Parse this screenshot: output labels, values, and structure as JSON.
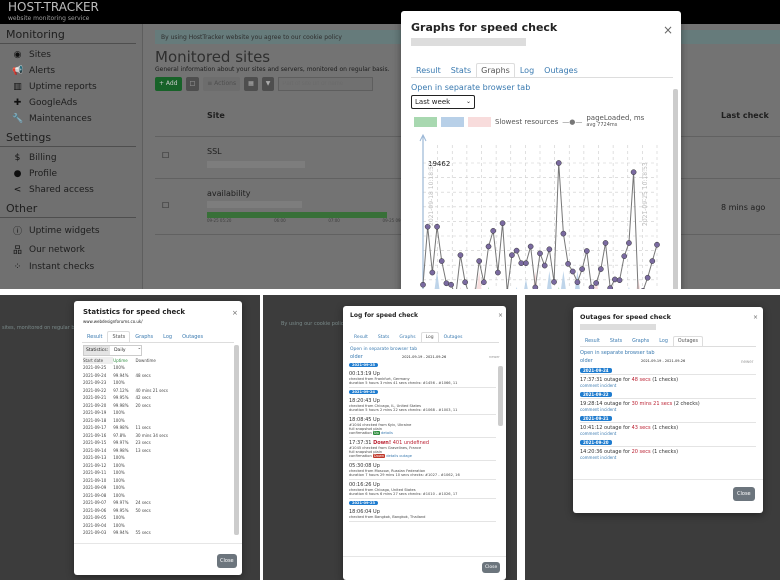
{
  "app": {
    "logo": "HOST-TRACKER",
    "tagline": "website monitoring service"
  },
  "sidebar": {
    "sections": [
      {
        "title": "Monitoring",
        "items": [
          {
            "label": "Sites",
            "icon": "globe-icon"
          },
          {
            "label": "Alerts",
            "icon": "megaphone-icon"
          },
          {
            "label": "Uptime reports",
            "icon": "bar-chart-icon"
          },
          {
            "label": "GoogleAds",
            "icon": "puzzle-icon"
          },
          {
            "label": "Maintenances",
            "icon": "wrench-icon"
          }
        ]
      },
      {
        "title": "Settings",
        "items": [
          {
            "label": "Billing",
            "icon": "dollar-icon"
          },
          {
            "label": "Profile",
            "icon": "user-icon"
          },
          {
            "label": "Shared access",
            "icon": "share-icon"
          }
        ]
      },
      {
        "title": "Other",
        "items": [
          {
            "label": "Uptime widgets",
            "icon": "info-icon"
          },
          {
            "label": "Our network",
            "icon": "network-icon"
          },
          {
            "label": "Instant checks",
            "icon": "spinner-icon"
          }
        ]
      }
    ]
  },
  "main": {
    "cookie": "By using HostTracker website you agree to our cookie policy",
    "title": "Monitored sites",
    "subtitle": "General information about your sites and servers, monitored on regular basis.",
    "toolbar": {
      "add": "+ Add",
      "actions": "≡ Actions",
      "search_placeholder": "Part of site url or name"
    },
    "columns": {
      "site": "Site",
      "last_check": "Last check"
    },
    "rows": [
      {
        "name": "SSL",
        "last_check": ""
      },
      {
        "name": "availability",
        "last_check": "8 mins ago",
        "timeline": [
          "09-25 05:20",
          "06:00",
          "07:00",
          "09-25 09:20"
        ]
      }
    ]
  },
  "tabs": [
    "Result",
    "Stats",
    "Graphs",
    "Log",
    "Outages"
  ],
  "graphs_modal": {
    "title": "Graphs for speed check",
    "open_link": "Open in separate browser tab",
    "range": "Last week",
    "legend": {
      "slowest": "Slowest resources",
      "series": "pageLoaded, ms",
      "avg": "avg 7724ms"
    },
    "colors": {
      "green": "#a8d8b0",
      "blue": "#b8d0e8",
      "pink": "#f8dcdc",
      "line": "#777777",
      "point": "#7a6aa0"
    }
  },
  "chart_data": {
    "type": "line",
    "series": [
      {
        "name": "pageLoaded, ms",
        "values": [
          3240,
          10970,
          4860,
          10970,
          6390,
          3430,
          3240,
          1710,
          7180,
          3570,
          1710,
          1390,
          6390,
          3570,
          8330,
          10420,
          4860,
          11440,
          2320,
          7180,
          7780,
          6110,
          6110,
          8330,
          2870,
          7410,
          5790,
          7960,
          3610,
          19462,
          10050,
          6020,
          5000,
          3570,
          5320,
          7730,
          2870,
          3470,
          5320,
          8800,
          2780,
          3940,
          3840,
          7040,
          8800,
          18240,
          1710,
          2410,
          4170,
          6390,
          8570
        ]
      }
    ],
    "max_label": "19462",
    "x_start": "2021-09-18 10:18:53",
    "x_end": "2021-09-25 10:18:53",
    "avg": 7724,
    "grid": true
  },
  "stats_modal": {
    "title": "Statistics for speed check",
    "url": "www.webdesignforums.co.uk/",
    "stat_label": "Statistics:",
    "period": "Daily",
    "headers": [
      "Start date",
      "Uptime",
      "Downtime"
    ],
    "rows": [
      [
        "2021-09-25",
        "100%",
        ""
      ],
      [
        "2021-09-24",
        "99.94%",
        "48 secs"
      ],
      [
        "2021-09-23",
        "100%",
        ""
      ],
      [
        "2021-09-22",
        "97.12%",
        "40 mins 21 secs"
      ],
      [
        "2021-09-21",
        "99.95%",
        "42 secs"
      ],
      [
        "2021-09-20",
        "99.98%",
        "20 secs"
      ],
      [
        "2021-09-19",
        "100%",
        ""
      ],
      [
        "2021-09-18",
        "100%",
        ""
      ],
      [
        "2021-09-17",
        "99.98%",
        "11 secs"
      ],
      [
        "2021-09-16",
        "97.8%",
        "30 mins 34 secs"
      ],
      [
        "2021-09-15",
        "99.97%",
        "23 secs"
      ],
      [
        "2021-09-14",
        "99.98%",
        "13 secs"
      ],
      [
        "2021-09-13",
        "100%",
        ""
      ],
      [
        "2021-09-12",
        "100%",
        ""
      ],
      [
        "2021-09-11",
        "100%",
        ""
      ],
      [
        "2021-09-10",
        "100%",
        ""
      ],
      [
        "2021-09-09",
        "100%",
        ""
      ],
      [
        "2021-09-08",
        "100%",
        ""
      ],
      [
        "2021-09-07",
        "99.97%",
        "24 secs"
      ],
      [
        "2021-09-06",
        "99.95%",
        "50 secs"
      ],
      [
        "2021-09-05",
        "100%",
        ""
      ],
      [
        "2021-09-04",
        "100%",
        ""
      ],
      [
        "2021-09-03",
        "99.94%",
        "55 secs"
      ]
    ],
    "close": "Close"
  },
  "log_modal": {
    "title": "Log for speed check",
    "open_link": "Open in separate browser tab",
    "older": "older",
    "newer": "newer",
    "range": "2021-09-19 - 2021-09-26",
    "entries": [
      {
        "date": "2021-09-25"
      },
      {
        "time": "00:13:19 Up",
        "l1": "checked from Frankfurt, Germany",
        "l2": "duration 5 hours 3 mins 41 secs checks: #1456 - #1066, 11"
      },
      {
        "date": "2021-09-24"
      },
      {
        "time": "18:20:43 Up",
        "l1": "checked from Chicago, IL, United States",
        "l2": "duration 5 hours 2 mins 22 secs checks: #1068 - #1003, 11"
      },
      {
        "time": "18:08:45 Up",
        "l1": "#1044 checked from Kyiv, Ukraine",
        "l2": "full snapshot plain",
        "conf": "confirmation",
        "tag": "Up",
        "tagc": "#2a8a3a",
        "links": "details"
      },
      {
        "time": "17:37:31",
        "down": "Down!",
        "err": "401 undefined",
        "l1": "#1045 checked from Gravelines, France",
        "l2": "full snapshot plain",
        "conf": "confirmation",
        "tag": "Down",
        "tagc": "#c0392b",
        "links": "details outage"
      },
      {
        "time": "05:30:08 Up",
        "l1": "checked from Moscow, Russian Federation",
        "l2": "duration 7 hours 29 mins 10 secs checks: #1027 - #1062, 16"
      },
      {
        "time": "00:16:26 Up",
        "l1": "checked from Chicago, United States",
        "l2": "duration 6 hours 6 mins 27 secs checks: #1010 - #1026, 17"
      },
      {
        "date": "2021-09-23"
      },
      {
        "time": "18:06:04 Up",
        "l1": "checked from Bangkok, Bangkok, Thailand",
        "l2": ""
      }
    ],
    "close": "Close"
  },
  "outages_modal": {
    "title": "Outages for speed check",
    "open_link": "Open in separate browser tab",
    "older": "older",
    "newer": "newer",
    "range": "2021-09-19 - 2021-09-26",
    "comment": "comment",
    "incident": "incident",
    "items": [
      {
        "date": "2021-09-24",
        "time": "17:37:31 outage for ",
        "dur": "48 secs",
        "checks": " (1 checks)"
      },
      {
        "date": "2021-09-22",
        "time": "19:28:14 outage for ",
        "dur": "30 mins 21 secs",
        "checks": " (2 checks)"
      },
      {
        "date": "2021-09-21",
        "time": "10:41:12 outage for ",
        "dur": "43 secs",
        "checks": " (1 checks)"
      },
      {
        "date": "2021-09-20",
        "time": "14:20:36 outage for ",
        "dur": "20 secs",
        "checks": " (1 checks)"
      }
    ],
    "close": "Close"
  }
}
